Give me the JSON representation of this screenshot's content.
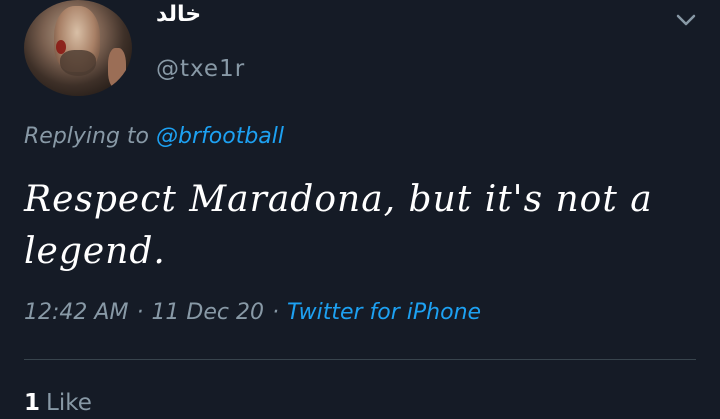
{
  "user": {
    "name": "خالد",
    "handle": "@txe1r"
  },
  "reply": {
    "prefix": "Replying to",
    "mention": "@brfootball"
  },
  "tweet": {
    "text": "Respect Maradona, but it's not a legend."
  },
  "meta": {
    "time": "12:42 AM",
    "separator": "·",
    "date": "11 Dec 20",
    "source": "Twitter for iPhone"
  },
  "stats": {
    "likes_count": "1",
    "likes_label": "Like"
  },
  "colors": {
    "background": "#151b26",
    "accent": "#1da1f2",
    "muted": "#8899a6",
    "text": "#ffffff"
  },
  "icons": {
    "menu": "chevron-down-icon"
  }
}
